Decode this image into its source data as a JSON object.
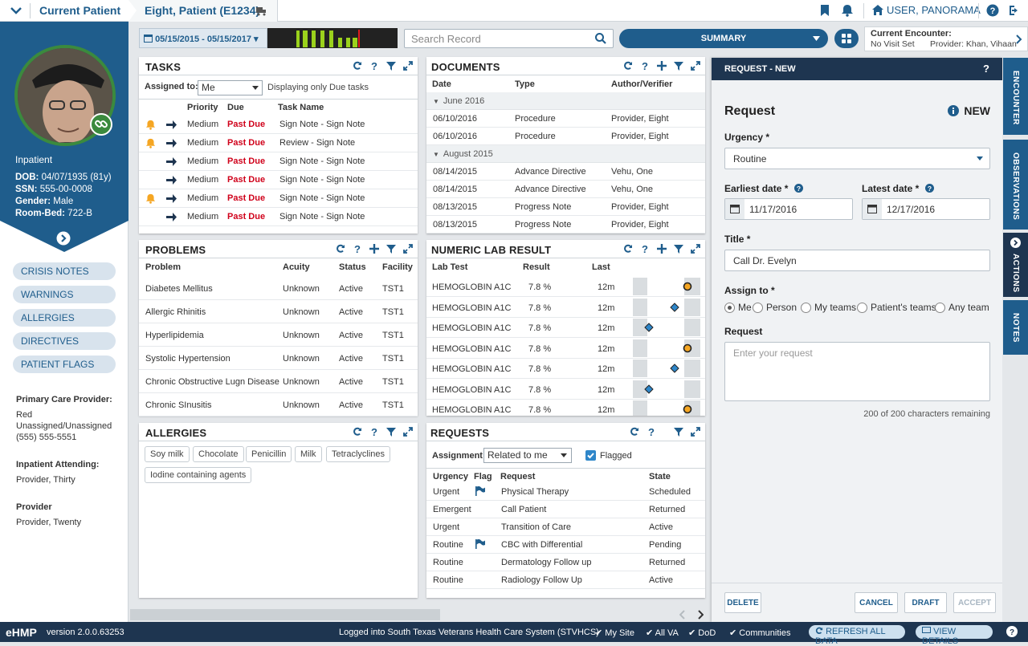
{
  "topbar": {
    "current_patient_label": "Current Patient",
    "patient_tab_label": "Eight, Patient (E1234)",
    "user_label": "USER, PANORAMA"
  },
  "sidebar": {
    "status": "Inpatient",
    "dob_label": "DOB:",
    "dob": "04/07/1935 (81y)",
    "ssn_label": "SSN:",
    "ssn": "555-00-0008",
    "gender_label": "Gender:",
    "gender": "Male",
    "roombed_label": "Room-Bed:",
    "roombed": "722-B",
    "nav": [
      "CRISIS NOTES",
      "WARNINGS",
      "ALLERGIES",
      "DIRECTIVES",
      "PATIENT FLAGS"
    ],
    "pcp_label": "Primary Care Provider:",
    "pcp_lines": [
      "Red",
      "Unassigned/Unassigned",
      "(555) 555-5551"
    ],
    "attending_label": "Inpatient Attending:",
    "attending": "Provider, Thirty",
    "provider_label": "Provider",
    "provider": "Provider, Twenty"
  },
  "toolbar": {
    "date_range": "05/15/2015 - 05/15/2017",
    "search_placeholder": "Search Record",
    "summary_label": "SUMMARY",
    "encounter_title": "Current Encounter:",
    "encounter_visit": "No Visit Set",
    "encounter_provider": "Provider: Khan, Vihaan"
  },
  "tasks": {
    "title": "TASKS",
    "assigned_label": "Assigned to:",
    "assigned_value": "Me",
    "displaying": "Displaying only Due tasks",
    "headers": [
      "Priority",
      "Due",
      "Task Name"
    ],
    "rows": [
      {
        "bell": true,
        "priority": "Medium",
        "due": "Past Due",
        "name": "Sign Note - Sign Note"
      },
      {
        "bell": true,
        "priority": "Medium",
        "due": "Past Due",
        "name": "Review - Sign Note"
      },
      {
        "bell": false,
        "priority": "Medium",
        "due": "Past Due",
        "name": "Sign Note - Sign Note"
      },
      {
        "bell": false,
        "priority": "Medium",
        "due": "Past Due",
        "name": "Sign Note - Sign Note"
      },
      {
        "bell": true,
        "priority": "Medium",
        "due": "Past Due",
        "name": "Sign Note - Sign Note"
      },
      {
        "bell": false,
        "priority": "Medium",
        "due": "Past Due",
        "name": "Sign Note - Sign Note"
      }
    ]
  },
  "documents": {
    "title": "DOCUMENTS",
    "headers": [
      "Date",
      "Type",
      "Author/Verifier"
    ],
    "groups": [
      {
        "label": "June 2016",
        "rows": [
          {
            "date": "06/10/2016",
            "type": "Procedure",
            "author": "Provider, Eight"
          },
          {
            "date": "06/10/2016",
            "type": "Procedure",
            "author": "Provider, Eight"
          }
        ]
      },
      {
        "label": "August 2015",
        "rows": [
          {
            "date": "08/14/2015",
            "type": "Advance Directive",
            "author": "Vehu, One"
          },
          {
            "date": "08/14/2015",
            "type": "Advance Directive",
            "author": "Vehu, One"
          },
          {
            "date": "08/13/2015",
            "type": "Progress Note",
            "author": "Provider, Eight"
          },
          {
            "date": "08/13/2015",
            "type": "Progress Note",
            "author": "Provider, Eight"
          }
        ]
      }
    ]
  },
  "problems": {
    "title": "PROBLEMS",
    "headers": [
      "Problem",
      "Acuity",
      "Status",
      "Facility"
    ],
    "rows": [
      {
        "problem": "Diabetes Mellitus",
        "acuity": "Unknown",
        "status": "Active",
        "facility": "TST1"
      },
      {
        "problem": "Allergic Rhinitis",
        "acuity": "Unknown",
        "status": "Active",
        "facility": "TST1"
      },
      {
        "problem": "Hyperlipidemia",
        "acuity": "Unknown",
        "status": "Active",
        "facility": "TST1"
      },
      {
        "problem": "Systolic Hypertension",
        "acuity": "Unknown",
        "status": "Active",
        "facility": "TST1"
      },
      {
        "problem": "Chronic Obstructive Lugn Disease",
        "acuity": "Unknown",
        "status": "Active",
        "facility": "TST1"
      },
      {
        "problem": "Chronic SInusitis",
        "acuity": "Unknown",
        "status": "Active",
        "facility": "TST1"
      }
    ]
  },
  "labs": {
    "title": "NUMERIC LAB RESULT",
    "headers": [
      "Lab Test",
      "Result",
      "Last"
    ],
    "rows": [
      {
        "test": "HEMOGLOBIN A1C",
        "result": "7.8 %",
        "last": "12m",
        "marker": "high"
      },
      {
        "test": "HEMOGLOBIN A1C",
        "result": "7.8 %",
        "last": "12m",
        "marker": "mid"
      },
      {
        "test": "HEMOGLOBIN A1C",
        "result": "7.8 %",
        "last": "12m",
        "marker": "low"
      },
      {
        "test": "HEMOGLOBIN A1C",
        "result": "7.8 %",
        "last": "12m",
        "marker": "high"
      },
      {
        "test": "HEMOGLOBIN A1C",
        "result": "7.8 %",
        "last": "12m",
        "marker": "mid"
      },
      {
        "test": "HEMOGLOBIN A1C",
        "result": "7.8 %",
        "last": "12m",
        "marker": "low"
      },
      {
        "test": "HEMOGLOBIN A1C",
        "result": "7.8 %",
        "last": "12m",
        "marker": "high"
      }
    ]
  },
  "allergies": {
    "title": "ALLERGIES",
    "chips": [
      "Soy milk",
      "Chocolate",
      "Penicillin",
      "Milk",
      "Tetraclyclines",
      "Iodine containing agents"
    ]
  },
  "requests": {
    "title": "REQUESTS",
    "assignment_label": "Assignment:",
    "assignment_value": "Related to me",
    "flagged_label": "Flagged",
    "headers": [
      "Urgency",
      "Flag",
      "Request",
      "State"
    ],
    "rows": [
      {
        "urgency": "Urgent",
        "flag": true,
        "request": "Physical Therapy",
        "state": "Scheduled"
      },
      {
        "urgency": "Emergent",
        "flag": false,
        "request": "Call Patient",
        "state": "Returned"
      },
      {
        "urgency": "Urgent",
        "flag": false,
        "request": "Transition of Care",
        "state": "Active"
      },
      {
        "urgency": "Routine",
        "flag": true,
        "request": "CBC with Differential",
        "state": "Pending"
      },
      {
        "urgency": "Routine",
        "flag": false,
        "request": "Dermatology Follow up",
        "state": "Returned"
      },
      {
        "urgency": "Routine",
        "flag": false,
        "request": "Radiology Follow Up",
        "state": "Active"
      }
    ]
  },
  "request_form": {
    "header": "REQUEST - NEW",
    "help": "?",
    "title": "Request",
    "badge": "NEW",
    "urgency_label": "Urgency *",
    "urgency_value": "Routine",
    "earliest_label": "Earliest date *",
    "earliest_value": "11/17/2016",
    "latest_label": "Latest date *",
    "latest_value": "12/17/2016",
    "title_label": "Title *",
    "title_value": "Call Dr. Evelyn",
    "assign_label": "Assign to *",
    "assign_options": [
      "Me",
      "Person",
      "My teams",
      "Patient's teams",
      "Any team"
    ],
    "request_label": "Request",
    "request_placeholder": "Enter your request",
    "chars_remaining": "200 of 200 characters remaining",
    "delete_label": "DELETE",
    "cancel_label": "CANCEL",
    "draft_label": "DRAFT",
    "accept_label": "ACCEPT"
  },
  "vtabs": [
    "ENCOUNTER",
    "OBSERVATIONS",
    "ACTIONS",
    "NOTES"
  ],
  "footer": {
    "brand": "eHMP",
    "version": "version 2.0.0.63253",
    "logged": "Logged into South Texas Veterans Health Care System (STVHCS)",
    "my_site": "My Site",
    "all_va": "All VA",
    "dod": "DoD",
    "communities": "Communities",
    "refresh": "REFRESH ALL DATA",
    "view_details": "VIEW DETAILS",
    "help": "?"
  },
  "colors": {
    "brand": "#1f5d8c",
    "navy": "#1e3550",
    "past_due": "#d0021b",
    "bell": "#f5a623"
  }
}
